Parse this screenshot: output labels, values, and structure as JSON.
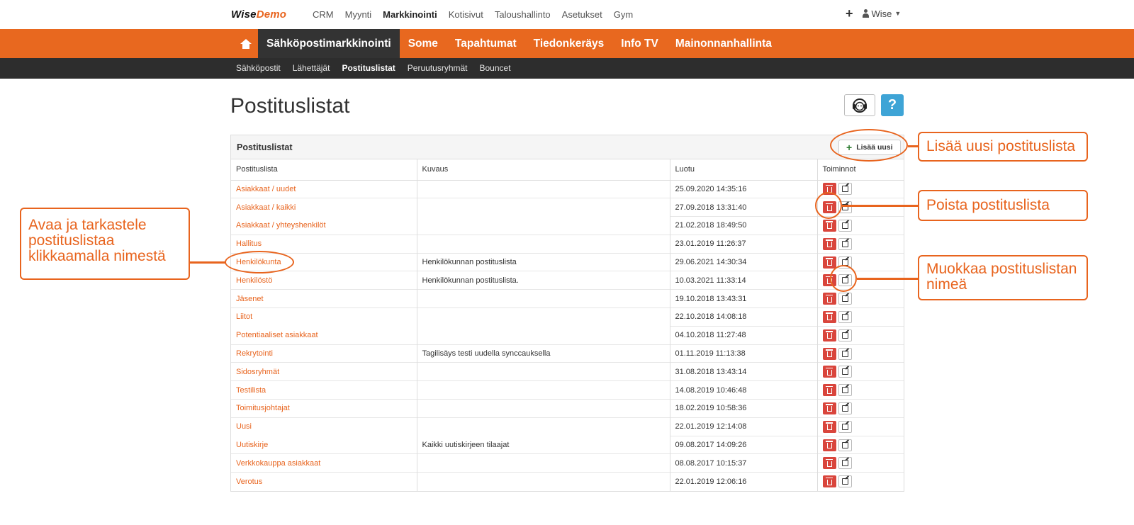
{
  "app": {
    "logo_part1": "Wise",
    "logo_part2": "Demo",
    "top_menu": [
      "CRM",
      "Myynti",
      "Markkinointi",
      "Kotisivut",
      "Taloushallinto",
      "Asetukset",
      "Gym"
    ],
    "top_menu_active": "Markkinointi",
    "user_name": "Wise"
  },
  "main_nav": {
    "items": [
      "Sähköpostimarkkinointi",
      "Some",
      "Tapahtumat",
      "Tiedonkeräys",
      "Info TV",
      "Mainonnanhallinta"
    ],
    "active": "Sähköpostimarkkinointi"
  },
  "sub_nav": {
    "items": [
      "Sähköpostit",
      "Lähettäjät",
      "Postituslistat",
      "Peruutusryhmät",
      "Bouncet"
    ],
    "active": "Postituslistat"
  },
  "page": {
    "title": "Postituslistat",
    "help_label": "?"
  },
  "panel": {
    "title": "Postituslistat",
    "add_label": "Lisää uusi",
    "columns": [
      "Postituslista",
      "Kuvaus",
      "Luotu",
      "Toiminnot"
    ],
    "rows": [
      {
        "name": "Asiakkaat / uudet",
        "desc": "",
        "created": "25.09.2020 14:35:16"
      },
      {
        "name": "Asiakkaat / kaikki",
        "desc": "",
        "created": "27.09.2018 13:31:40"
      },
      {
        "name": "Asiakkaat / yhteyshenkilöt",
        "desc": "",
        "created": "21.02.2018 18:49:50"
      },
      {
        "name": "Hallitus",
        "desc": "",
        "created": "23.01.2019 11:26:37"
      },
      {
        "name": "Henkilökunta",
        "desc": "Henkilökunnan postituslista",
        "created": "29.06.2021 14:30:34"
      },
      {
        "name": "Henkilöstö",
        "desc": "Henkilökunnan postituslista.",
        "created": "10.03.2021 11:33:14"
      },
      {
        "name": "Jäsenet",
        "desc": "",
        "created": "19.10.2018 13:43:31"
      },
      {
        "name": "Liitot",
        "desc": "",
        "created": "22.10.2018 14:08:18"
      },
      {
        "name": "Potentiaaliset asiakkaat",
        "desc": "",
        "created": "04.10.2018 11:27:48"
      },
      {
        "name": "Rekrytointi",
        "desc": "Tagilisäys testi uudella synccauksella",
        "created": "01.11.2019 11:13:38"
      },
      {
        "name": "Sidosryhmät",
        "desc": "",
        "created": "31.08.2018 13:43:14"
      },
      {
        "name": "Testilista",
        "desc": "",
        "created": "14.08.2019 10:46:48"
      },
      {
        "name": "Toimitusjohtajat",
        "desc": "",
        "created": "18.02.2019 10:58:36"
      },
      {
        "name": "Uusi",
        "desc": "",
        "created": "22.01.2019 12:14:08"
      },
      {
        "name": "Uutiskirje",
        "desc": "Kaikki uutiskirjeen tilaajat",
        "created": "09.08.2017 14:09:26"
      },
      {
        "name": "Verkkokauppa asiakkaat",
        "desc": "",
        "created": "08.08.2017 10:15:37"
      },
      {
        "name": "Verotus",
        "desc": "",
        "created": "22.01.2019 12:06:16"
      }
    ]
  },
  "annotations": {
    "add_new": "Lisää uusi postituslista",
    "delete": "Poista postituslista",
    "edit_line1": "Muokkaa postituslistan",
    "edit_line2": "nimeä",
    "open_line1": "Avaa ja tarkastele",
    "open_line2": "postituslistaa",
    "open_line3": "klikkaamalla nimestä"
  },
  "colors": {
    "accent": "#e8641e",
    "nav_dark": "#2d2d2d",
    "delete_red": "#d9453c",
    "help_blue": "#3ea4d6"
  }
}
